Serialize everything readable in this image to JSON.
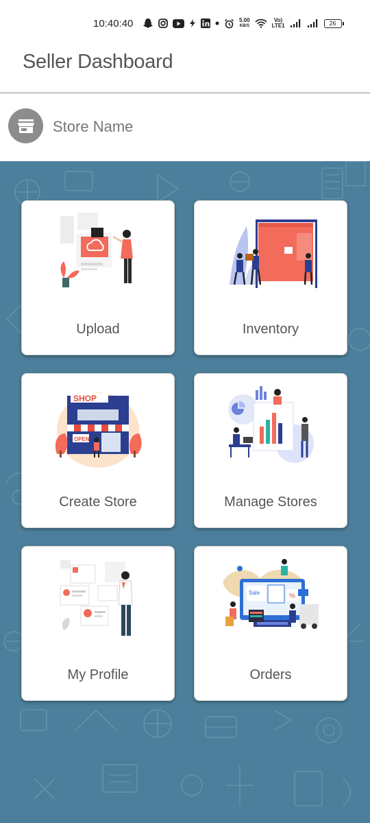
{
  "status_bar": {
    "time": "10:40:40",
    "net_speed_value": "5.00",
    "net_speed_unit": "KB/S",
    "volte_top": "Vo)",
    "volte_bottom": "LTE1",
    "battery": "26",
    "icons": [
      "snapchat-icon",
      "instagram-icon",
      "youtube-icon",
      "bolt-icon",
      "linkedin-icon",
      "dot-icon",
      "alarm-icon",
      "wifi-icon",
      "signal-icon",
      "signal-icon",
      "battery-icon"
    ]
  },
  "app_bar": {
    "title": "Seller Dashboard"
  },
  "store": {
    "name": "Store Name",
    "icon": "storefront-icon"
  },
  "tiles": [
    {
      "label": "Upload",
      "illustration": "upload-illustration"
    },
    {
      "label": "Inventory",
      "illustration": "inventory-illustration"
    },
    {
      "label": "Create Store",
      "illustration": "shop-illustration"
    },
    {
      "label": "Manage Stores",
      "illustration": "analytics-illustration"
    },
    {
      "label": "My Profile",
      "illustration": "profile-illustration"
    },
    {
      "label": "Orders",
      "illustration": "orders-illustration"
    }
  ],
  "illustration_text": {
    "shop_sign": "SHOP",
    "open_sign": "OPEN",
    "sale_tag": "Sale",
    "percent": "%"
  },
  "colors": {
    "background": "#4c7f9b",
    "card": "#ffffff",
    "accent": "#f26b5b",
    "navy": "#2c3e8f"
  }
}
